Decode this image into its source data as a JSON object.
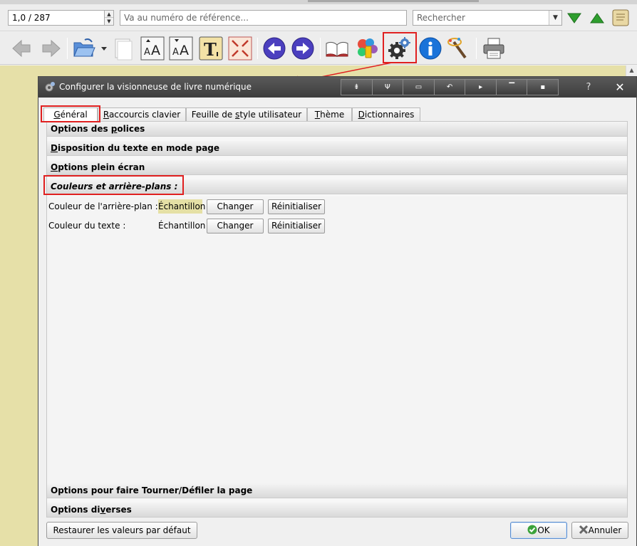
{
  "nav": {
    "page_field": "1,0 / 287",
    "reference_placeholder": "Va au numéro de référence...",
    "search_placeholder": "Rechercher"
  },
  "dialog": {
    "title": "Configurer la visionneuse de livre numérique",
    "help": "?",
    "close": "✕",
    "tabs": [
      {
        "label": "Général",
        "ul": "G",
        "rest": "énéral",
        "pre": ""
      },
      {
        "label": "Raccourcis clavier",
        "pre": "",
        "ul": "R",
        "rest": "accourcis clavier"
      },
      {
        "label": "Feuille de style utilisateur",
        "pre": "Feuille de ",
        "ul": "s",
        "rest": "tyle utilisateur"
      },
      {
        "label": "Thème",
        "pre": "",
        "ul": "T",
        "rest": "hème"
      },
      {
        "label": "Dictionnaires",
        "pre": "",
        "ul": "D",
        "rest": "ictionnaires"
      }
    ],
    "sections": {
      "fonts": {
        "pre": "Options des ",
        "ul": "p",
        "rest": "olices"
      },
      "layout": {
        "pre": "",
        "ul": "D",
        "rest": "isposition du texte en mode page"
      },
      "fullscreen": {
        "pre": "",
        "ul": "O",
        "rest": "ptions plein écran"
      },
      "colors": "Couleurs et arrière-plans :",
      "page_turn": {
        "pre": "Options pour faire Tourner/Déf",
        "ul": "i",
        "rest": "ler la page"
      },
      "misc": {
        "pre": "Options di",
        "ul": "v",
        "rest": "erses"
      }
    },
    "colors": {
      "background_label": "Couleur de l'arrière-plan :",
      "text_label": "Couleur du texte :",
      "sample": "Échantillon",
      "change": "Changer",
      "reset": "Réinitialiser",
      "background_sample_color": "#e5e0a5"
    },
    "footer": {
      "restore_defaults": "Restaurer les valeurs par défaut",
      "ok": "OK",
      "cancel": "Annuler"
    }
  },
  "icons": [
    "back-arrow-icon",
    "forward-arrow-icon",
    "open-folder-icon",
    "blank-page-icon",
    "font-larger-icon",
    "font-smaller-icon",
    "text-icon",
    "fullscreen-icon",
    "previous-icon",
    "next-icon",
    "book-icon",
    "paint-icon",
    "settings-gears-icon",
    "info-icon",
    "magic-wand-icon",
    "print-icon",
    "arrow-down-icon",
    "arrow-up-icon",
    "scroll-icon"
  ],
  "colors_meta": {
    "highlight_red": "#e02020",
    "book_background": "#e6e0a8",
    "title_bar": "#444444"
  }
}
